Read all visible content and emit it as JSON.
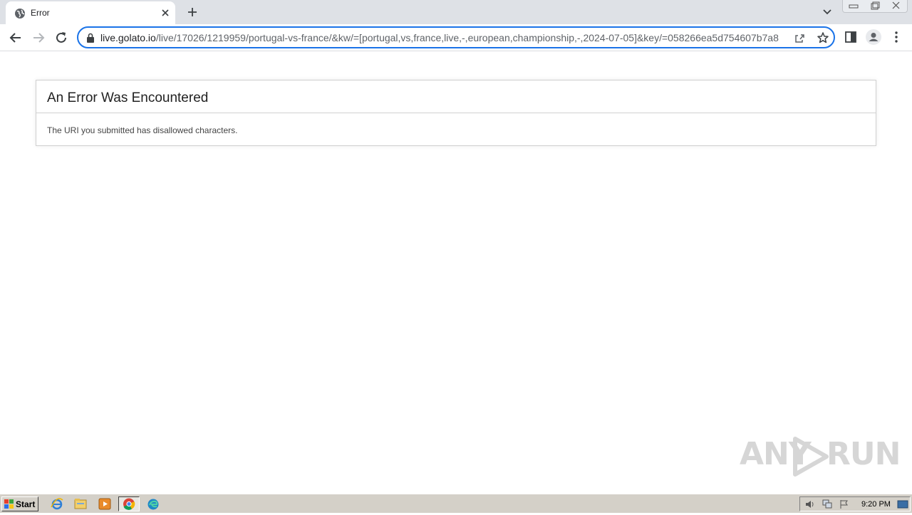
{
  "browser": {
    "tab": {
      "title": "Error"
    },
    "address_bar": {
      "host": "live.golato.io",
      "path": "/live/17026/1219959/portugal-vs-france/&kw/=[portugal,vs,france,live,-,european,championship,-,2024-07-05]&key/=058266ea5d754607b7a8"
    },
    "accent_color": "#1a73e8"
  },
  "page": {
    "heading": "An Error Was Encountered",
    "message": "The URI you submitted has disallowed characters."
  },
  "watermark": {
    "left": "ANY",
    "right": "RUN"
  },
  "taskbar": {
    "start_label": "Start",
    "clock": "9:20 PM",
    "pinned": [
      "ie-icon",
      "explorer-icon",
      "media-player-icon",
      "chrome-icon",
      "edge-icon"
    ]
  }
}
